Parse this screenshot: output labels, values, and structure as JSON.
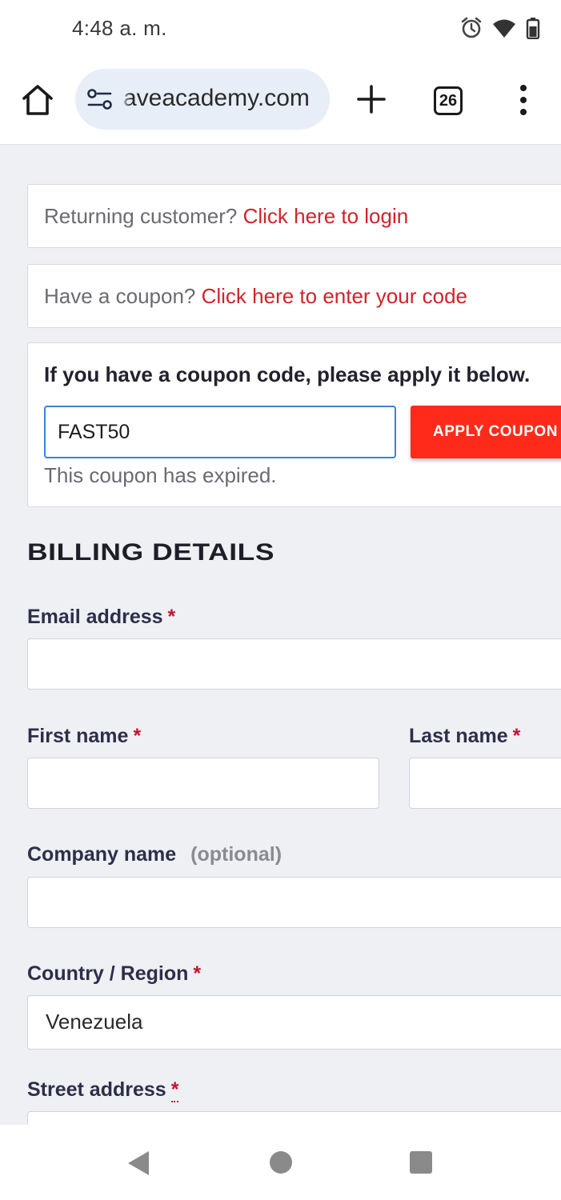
{
  "status_bar": {
    "time": "4:48 a. m.",
    "icons": [
      "alarm-icon",
      "wifi-icon",
      "battery-icon"
    ]
  },
  "browser": {
    "url": "aveacademy.com",
    "tab_count": "26",
    "icons": [
      "home-icon",
      "site-settings-icon",
      "plus-icon",
      "tabs-icon",
      "more-vert-icon"
    ]
  },
  "notices": {
    "returning_prefix": "Returning customer? ",
    "returning_link": "Click here to login",
    "coupon_prefix": "Have a coupon? ",
    "coupon_link": "Click here to enter your code"
  },
  "coupon_form": {
    "title": "If you have a coupon code, please apply it below.",
    "code_value": "FAST50",
    "apply_label": "APPLY COUPON",
    "message": "This coupon has expired."
  },
  "billing": {
    "heading": "BILLING DETAILS",
    "required_mark": "*",
    "email_label": "Email address",
    "first_name_label": "First name",
    "last_name_label": "Last name",
    "company_label": "Company name",
    "optional_text": "(optional)",
    "country_label": "Country / Region",
    "country_value": "Venezuela",
    "street_label": "Street address"
  },
  "colors": {
    "link_red": "#d0232b",
    "button_red": "#ff2a1a",
    "page_bg": "#eef0f4",
    "url_pill_bg": "#e8eef8"
  },
  "nav_bar": {
    "icons": [
      "back-icon",
      "home-circle-icon",
      "recents-square-icon"
    ]
  }
}
